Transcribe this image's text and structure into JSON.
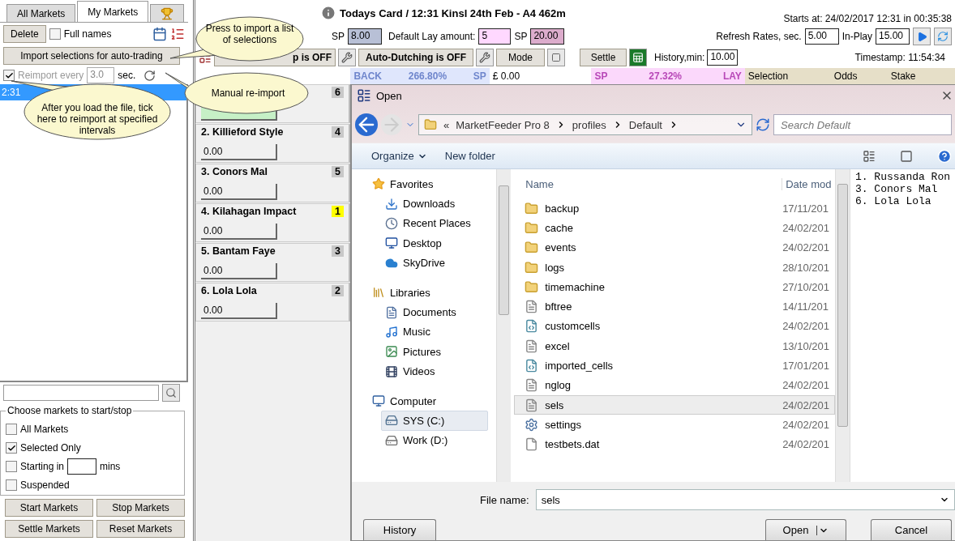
{
  "left_panel": {
    "tabs": [
      {
        "label": "All Markets",
        "selected": false
      },
      {
        "label": "My Markets",
        "selected": true
      }
    ],
    "delete_button": "Delete",
    "full_names": {
      "label": "Full names",
      "checked": false
    },
    "import_button": "Import selections for auto-trading",
    "reimport": {
      "label": "Reimport every",
      "checked": true,
      "value": "3.0",
      "unit": "sec."
    },
    "markets": [
      {
        "label": "2:31",
        "selected": true
      }
    ],
    "group": {
      "title": "Choose markets to start/stop",
      "options": [
        {
          "label": "All Markets",
          "checked": false
        },
        {
          "label": "Selected Only",
          "checked": true
        },
        {
          "label": "Starting in",
          "checked": false,
          "unit": "mins"
        },
        {
          "label": "Suspended",
          "checked": false
        }
      ]
    },
    "buttons": [
      "Start Markets",
      "Stop Markets",
      "Settle Markets",
      "Reset Markets"
    ]
  },
  "header": {
    "title": "Todays Card / 12:31 Kinsl 24th Feb - A4 462m",
    "starts": "Starts at: 24/02/2017 12:31 in 00:35:38",
    "back_sp_label": "SP",
    "back_sp": "8.00",
    "lay_label": "Default Lay amount:",
    "lay_amount": "5",
    "lay_sp_label": "SP",
    "lay_sp": "20.00",
    "refresh_label": "Refresh Rates, sec.",
    "refresh": "5.00",
    "inplay_label": "In-Play",
    "inplay": "15.00",
    "stop_button": "p is OFF",
    "dutching_button": "Auto-Dutching is OFF",
    "mode_button": "Mode",
    "settle_button": "Settle",
    "history_label": "History,min:",
    "history": "10.00",
    "timestamp": "Timestamp: 11:54:34"
  },
  "columns": {
    "back": "BACK",
    "back_pct": "266.80%",
    "back_sp": "SP",
    "total": "£ 0.00",
    "lay_sp": "SP",
    "lay_pct": "27.32%",
    "lay": "LAY",
    "selection": "Selection",
    "odds": "Odds",
    "stake": "Stake"
  },
  "runners": [
    {
      "badge": "6",
      "badge_highlight": false,
      "field_active": true
    },
    {
      "name": "2. Killieford Style",
      "badge": "4",
      "badge_highlight": false,
      "stake": "0.00",
      "field_active": false
    },
    {
      "name": "3. Conors Mal",
      "badge": "5",
      "badge_highlight": false,
      "stake": "0.00",
      "field_active": false
    },
    {
      "name": "4. Kilahagan Impact",
      "badge": "1",
      "badge_highlight": true,
      "stake": "0.00",
      "field_active": false
    },
    {
      "name": "5. Bantam Faye",
      "badge": "3",
      "badge_highlight": false,
      "stake": "0.00",
      "field_active": false
    },
    {
      "name": "6. Lola Lola",
      "badge": "2",
      "badge_highlight": false,
      "stake": "0.00",
      "field_active": false
    }
  ],
  "callouts": [
    "Press to import a list of selections",
    "After you load the file, tick here to reimport at specified intervals",
    "Manual re-import"
  ],
  "dialog": {
    "title": "Open",
    "breadcrumb": [
      "«",
      "MarketFeeder Pro 8",
      "profiles",
      "Default"
    ],
    "search_placeholder": "Search Default",
    "toolbar": [
      "Organize",
      "New folder"
    ],
    "nav": [
      {
        "label": "Favorites",
        "kind": "star",
        "selected": false
      },
      {
        "label": "Downloads",
        "kind": "download",
        "selected": false
      },
      {
        "label": "Recent Places",
        "kind": "recent",
        "selected": false
      },
      {
        "label": "Desktop",
        "kind": "desktop",
        "selected": false
      },
      {
        "label": "SkyDrive",
        "kind": "cloud",
        "selected": false
      },
      {
        "label": "Libraries",
        "kind": "library",
        "selected": false
      },
      {
        "label": "Documents",
        "kind": "document",
        "selected": false
      },
      {
        "label": "Music",
        "kind": "music",
        "selected": false
      },
      {
        "label": "Pictures",
        "kind": "pictures",
        "selected": false
      },
      {
        "label": "Videos",
        "kind": "videos",
        "selected": false
      },
      {
        "label": "Computer",
        "kind": "computer",
        "selected": false
      },
      {
        "label": "SYS (C:)",
        "kind": "drive",
        "selected": true
      },
      {
        "label": "Work (D:)",
        "kind": "disk",
        "selected": false
      }
    ],
    "columns": [
      "Name",
      "Date mod"
    ],
    "files": [
      {
        "name": "backup",
        "date": "17/11/201",
        "kind": "folder",
        "selected": false
      },
      {
        "name": "cache",
        "date": "24/02/201",
        "kind": "folder",
        "selected": false
      },
      {
        "name": "events",
        "date": "24/02/201",
        "kind": "folder",
        "selected": false
      },
      {
        "name": "logs",
        "date": "28/10/201",
        "kind": "folder",
        "selected": false
      },
      {
        "name": "timemachine",
        "date": "27/10/201",
        "kind": "folder",
        "selected": false
      },
      {
        "name": "bftree",
        "date": "14/11/201",
        "kind": "text",
        "selected": false
      },
      {
        "name": "customcells",
        "date": "24/02/201",
        "kind": "xml",
        "selected": false
      },
      {
        "name": "excel",
        "date": "13/10/201",
        "kind": "text",
        "selected": false
      },
      {
        "name": "imported_cells",
        "date": "17/01/201",
        "kind": "xml",
        "selected": false
      },
      {
        "name": "nglog",
        "date": "24/02/201",
        "kind": "text",
        "selected": false
      },
      {
        "name": "sels",
        "date": "24/02/201",
        "kind": "text",
        "selected": true
      },
      {
        "name": "settings",
        "date": "24/02/201",
        "kind": "config",
        "selected": false
      },
      {
        "name": "testbets.dat",
        "date": "24/02/201",
        "kind": "blank",
        "selected": false
      }
    ],
    "preview": [
      "1. Russanda Ron",
      "3. Conors Mal",
      "6. Lola Lola"
    ],
    "file_name_label": "File name:",
    "file_name": "sels",
    "open_button": "Open",
    "cancel_button": "Cancel",
    "history_button": "History"
  }
}
